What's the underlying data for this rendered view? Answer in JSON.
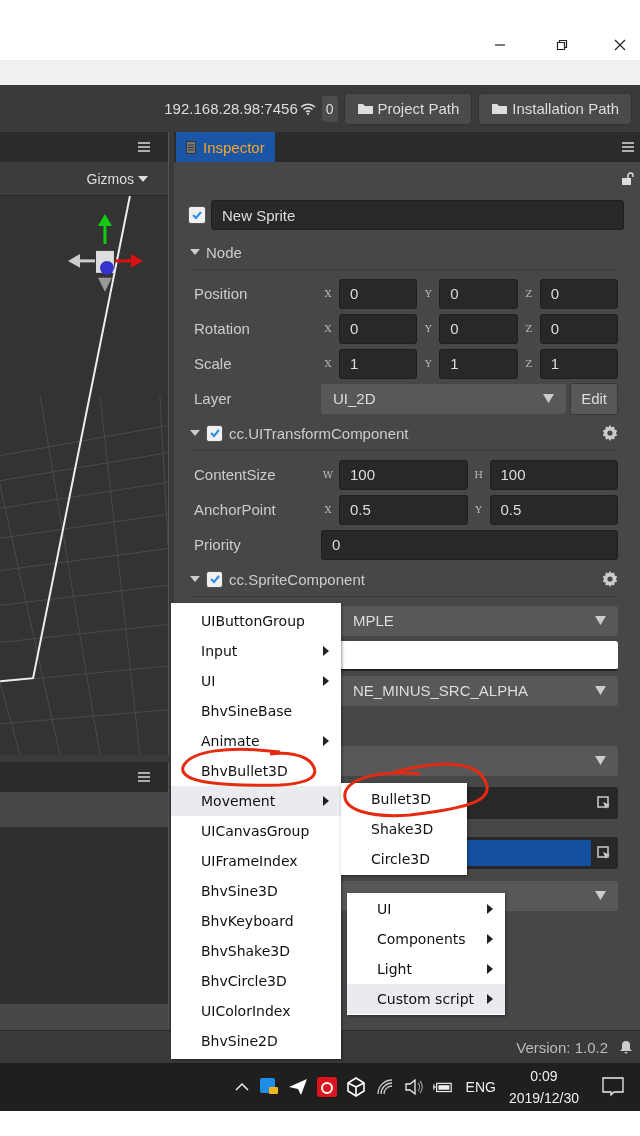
{
  "toolbar": {
    "address": "192.168.28.98:7456",
    "count": "0",
    "buttons": [
      "Project Path",
      "Installation Path"
    ]
  },
  "scene_panel": {
    "gizmos": "Gizmos"
  },
  "inspector": {
    "tab": "Inspector",
    "node_enabled": true,
    "node_name": "New Sprite",
    "sections": [
      {
        "title": "Node",
        "expanded": true,
        "rows": [
          {
            "kind": "vec",
            "label": "Position",
            "fields": [
              {
                "axis": "X",
                "value": "0"
              },
              {
                "axis": "Y",
                "value": "0"
              },
              {
                "axis": "Z",
                "value": "0"
              }
            ]
          },
          {
            "kind": "vec",
            "label": "Rotation",
            "fields": [
              {
                "axis": "X",
                "value": "0"
              },
              {
                "axis": "Y",
                "value": "0"
              },
              {
                "axis": "Z",
                "value": "0"
              }
            ]
          },
          {
            "kind": "vec",
            "label": "Scale",
            "fields": [
              {
                "axis": "X",
                "value": "1"
              },
              {
                "axis": "Y",
                "value": "1"
              },
              {
                "axis": "Z",
                "value": "1"
              }
            ]
          },
          {
            "kind": "select",
            "label": "Layer",
            "value": "UI_2D",
            "button": "Edit"
          }
        ]
      },
      {
        "title": "cc.UITransformComponent",
        "checked": true,
        "expanded": true,
        "rows": [
          {
            "kind": "vec",
            "label": "ContentSize",
            "fields": [
              {
                "axis": "W",
                "value": "100"
              },
              {
                "axis": "H",
                "value": "100"
              }
            ]
          },
          {
            "kind": "vec",
            "label": "AnchorPoint",
            "fields": [
              {
                "axis": "X",
                "value": "0.5"
              },
              {
                "axis": "Y",
                "value": "0.5"
              }
            ]
          },
          {
            "kind": "number",
            "label": "Priority",
            "value": "0"
          }
        ]
      },
      {
        "title": "cc.SpriteComponent",
        "checked": true,
        "expanded": true,
        "rows": [
          {
            "kind": "select",
            "value": "MPLE"
          },
          {
            "kind": "color"
          },
          {
            "kind": "select",
            "value": "NE_MINUS_SRC_ALPHA"
          },
          {
            "kind": "blank"
          },
          {
            "kind": "select"
          },
          {
            "kind": "asset",
            "highlighted": false
          },
          {
            "kind": "asset",
            "highlighted": true
          },
          {
            "kind": "select"
          }
        ]
      }
    ]
  },
  "context_menu": {
    "items": [
      {
        "label": "UIButtonGroup",
        "has_submenu": false,
        "highlighted": false
      },
      {
        "label": "Input",
        "has_submenu": true,
        "highlighted": false
      },
      {
        "label": "UI",
        "has_submenu": true,
        "highlighted": false
      },
      {
        "label": "BhvSineBase",
        "has_submenu": false,
        "highlighted": false
      },
      {
        "label": "Animate",
        "has_submenu": true,
        "highlighted": false
      },
      {
        "label": "BhvBullet3D",
        "has_submenu": false,
        "highlighted": false
      },
      {
        "label": "Movement",
        "has_submenu": true,
        "highlighted": true
      },
      {
        "label": "UICanvasGroup",
        "has_submenu": false,
        "highlighted": false
      },
      {
        "label": "UIFrameIndex",
        "has_submenu": false,
        "highlighted": false
      },
      {
        "label": "BhvSine3D",
        "has_submenu": false,
        "highlighted": false
      },
      {
        "label": "BhvKeyboard",
        "has_submenu": false,
        "highlighted": false
      },
      {
        "label": "BhvShake3D",
        "has_submenu": false,
        "highlighted": false
      },
      {
        "label": "BhvCircle3D",
        "has_submenu": false,
        "highlighted": false
      },
      {
        "label": "UIColorIndex",
        "has_submenu": false,
        "highlighted": false
      },
      {
        "label": "BhvSine2D",
        "has_submenu": false,
        "highlighted": false
      }
    ],
    "submenus": [
      {
        "items": [
          {
            "label": "Bullet3D",
            "has_submenu": false,
            "highlighted": false
          },
          {
            "label": "Shake3D",
            "has_submenu": false,
            "highlighted": false
          },
          {
            "label": "Circle3D",
            "has_submenu": false,
            "highlighted": false
          }
        ]
      },
      {
        "items": [
          {
            "label": "UI",
            "has_submenu": true,
            "highlighted": false
          },
          {
            "label": "Components",
            "has_submenu": true,
            "highlighted": false
          },
          {
            "label": "Light",
            "has_submenu": true,
            "highlighted": false
          },
          {
            "label": "Custom script",
            "has_submenu": true,
            "highlighted": true
          }
        ]
      }
    ]
  },
  "status_bar": {
    "version": "Version: 1.0.2"
  },
  "taskbar": {
    "language": "ENG",
    "time": "0:09",
    "date": "2019/12/30"
  }
}
